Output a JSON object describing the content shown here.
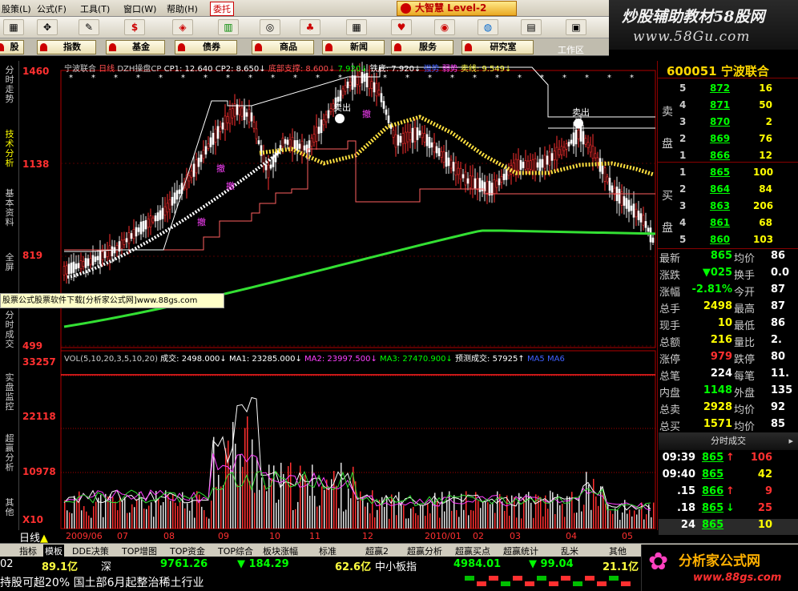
{
  "menu": {
    "items": [
      "股策(L)",
      "公式(F)",
      "工具(T)",
      "窗口(W)",
      "帮助(H)"
    ],
    "highlight": "委托",
    "brand": "大智慧 Level-2"
  },
  "watermark": {
    "line1": "炒股辅助教材58股网",
    "line2": "www.58Gu.com"
  },
  "toolbar": {
    "icons": [
      "grid-icon",
      "move-icon",
      "pencil-icon",
      "dollar-icon",
      "pattern-icon",
      "bars-icon",
      "binoculars-icon",
      "people-icon",
      "grid2-icon",
      "heart-icon",
      "globe-icon",
      "chart-icon",
      "window-icon",
      "user-icon"
    ]
  },
  "navbar": {
    "items": [
      "股",
      "指数",
      "基金",
      "债券",
      "商品",
      "新闻",
      "服务",
      "研究室"
    ],
    "workzone": "工作区"
  },
  "vtabs": [
    "分时走势",
    "技术分析",
    "基本资料",
    "全屏",
    "分时成交",
    "实盘监控",
    "超赢分析",
    "其他"
  ],
  "chart": {
    "header1": [
      {
        "text": "宁波联合",
        "color": "#cccccc"
      },
      {
        "text": " 日线 ",
        "color": "#ff5050"
      },
      {
        "text": "DZH操盘CP ",
        "color": "#cccccc"
      },
      {
        "text": "CP1: 12.640 ",
        "color": "#ffffff"
      },
      {
        "text": "CP2: 8.650↓ ",
        "color": "#ffffff"
      },
      {
        "text": "底部支撑: 8.600↓ ",
        "color": "#ff5050"
      },
      {
        "text": "7.920↓ ",
        "color": "#00ff00"
      },
      {
        "text": "铁底: 7.920↓ ",
        "color": "#ffffff"
      },
      {
        "text": "强势 ",
        "color": "#4060ff"
      },
      {
        "text": "弱势 ",
        "color": "#ff40ff"
      },
      {
        "text": "卖线: 9.549↓",
        "color": "#ffff40"
      }
    ],
    "header2": [
      {
        "text": "VOL(5,10,20,3,5,10,20) ",
        "color": "#cccccc"
      },
      {
        "text": "成交: 2498.000↓ ",
        "color": "#ffffff"
      },
      {
        "text": "MA1: 23285.000↓ ",
        "color": "#ffffff"
      },
      {
        "text": "MA2: 23997.500↓ ",
        "color": "#ff40ff"
      },
      {
        "text": "MA3: 27470.900↓ ",
        "color": "#00ff00"
      },
      {
        "text": "预测成交: 57925↑ ",
        "color": "#ffffff"
      },
      {
        "text": "MA5 ",
        "color": "#4060ff"
      },
      {
        "text": "MA6",
        "color": "#4060ff"
      }
    ],
    "price_ticks": [
      "1460",
      "1138",
      "819",
      "499"
    ],
    "volume_ticks": [
      "33257",
      "22118",
      "10978",
      "X10"
    ],
    "date_labels": [
      "2009/06",
      "07",
      "08",
      "09",
      "10",
      "11",
      "12",
      "2010/01",
      "02",
      "03",
      "04",
      "05"
    ],
    "period_label": "日线",
    "banner": "股票公式股票软件下载[分析家公式网]www.88gs.com",
    "sell_label": "卖出",
    "annotations": [
      "撤",
      "撤",
      "撤",
      "撤"
    ]
  },
  "quote": {
    "code": "600051",
    "name": "宁波联合",
    "sell_side": "卖盘",
    "buy_side": "买盘",
    "asks": [
      {
        "lvl": "5",
        "price": "872",
        "vol": "16"
      },
      {
        "lvl": "4",
        "price": "871",
        "vol": "50"
      },
      {
        "lvl": "3",
        "price": "870",
        "vol": "2"
      },
      {
        "lvl": "2",
        "price": "869",
        "vol": "76"
      },
      {
        "lvl": "1",
        "price": "866",
        "vol": "12"
      }
    ],
    "bids": [
      {
        "lvl": "1",
        "price": "865",
        "vol": "100"
      },
      {
        "lvl": "2",
        "price": "864",
        "vol": "84"
      },
      {
        "lvl": "3",
        "price": "863",
        "vol": "206"
      },
      {
        "lvl": "4",
        "price": "861",
        "vol": "68"
      },
      {
        "lvl": "5",
        "price": "860",
        "vol": "103"
      }
    ],
    "stats": [
      {
        "l1": "最新",
        "v1": "865",
        "c1": "#00ff00",
        "l2": "均价",
        "v2": "86"
      },
      {
        "l1": "涨跌",
        "v1": "▼025",
        "c1": "#00ff00",
        "l2": "换手",
        "v2": "0.0"
      },
      {
        "l1": "涨幅",
        "v1": "-2.81%",
        "c1": "#00ff00",
        "l2": "今开",
        "v2": "87"
      },
      {
        "l1": "总手",
        "v1": "2498",
        "c1": "#ffff00",
        "l2": "最高",
        "v2": "87"
      },
      {
        "l1": "现手",
        "v1": "10",
        "c1": "#ffff00",
        "l2": "最低",
        "v2": "86"
      },
      {
        "l1": "总额",
        "v1": "216",
        "c1": "#ffff00",
        "l2": "量比",
        "v2": "2."
      },
      {
        "l1": "涨停",
        "v1": "979",
        "c1": "#ff3030",
        "l2": "跌停",
        "v2": "80"
      },
      {
        "l1": "总笔",
        "v1": "224",
        "c1": "#ffffff",
        "l2": "每笔",
        "v2": "11."
      },
      {
        "l1": "内盘",
        "v1": "1148",
        "c1": "#00ff00",
        "l2": "外盘",
        "v2": "135"
      },
      {
        "l1": "总卖",
        "v1": "2928",
        "c1": "#ffff00",
        "l2": "均价",
        "v2": "92"
      },
      {
        "l1": "总买",
        "v1": "1571",
        "c1": "#ffff00",
        "l2": "均价",
        "v2": "85"
      }
    ],
    "ticks_header": "分时成交",
    "ticks": [
      {
        "t": "09:39",
        "p": "865",
        "arrow": "↑",
        "v": "106",
        "pc": "#00ff00",
        "ac": "#ff3030",
        "vc": "#ff3030"
      },
      {
        "t": "09:40",
        "p": "865",
        "arrow": "",
        "v": "42",
        "pc": "#00ff00",
        "ac": "#ffffff",
        "vc": "#ffff00"
      },
      {
        "t": ".15",
        "p": "866",
        "arrow": "↑",
        "v": "9",
        "pc": "#00ff00",
        "ac": "#ff3030",
        "vc": "#ff3030"
      },
      {
        "t": ".18",
        "p": "865",
        "arrow": "↓",
        "v": "25",
        "pc": "#00ff00",
        "ac": "#00ff00",
        "vc": "#ff3030"
      },
      {
        "t": "24",
        "p": "865",
        "arrow": "",
        "v": "10",
        "pc": "#00ff00",
        "ac": "#ffffff",
        "vc": "#ffff00"
      }
    ]
  },
  "bottom_tabs": [
    "指标",
    "模板",
    "DDE决策",
    "TOP增图",
    "TOP资金",
    "TOP综合",
    "板块涨幅",
    "标准",
    "超赢2",
    "超赢分析",
    "超赢买点",
    "超赢统计",
    "乱米",
    "其他"
  ],
  "status1": {
    "a": "02",
    "b": "89.1亿",
    "c": "深",
    "d": "9761.26",
    "e": "▼ 184.29",
    "f": "62.6亿",
    "g": "中小板指",
    "h": "4984.01",
    "i": "▼ 99.04",
    "j": "21.1亿"
  },
  "status2": {
    "ticker": "持股可超20% 国土部6月起整治稀土行业"
  },
  "logo": {
    "line1": "分析家公式网",
    "line2": "www.88gs.com"
  }
}
